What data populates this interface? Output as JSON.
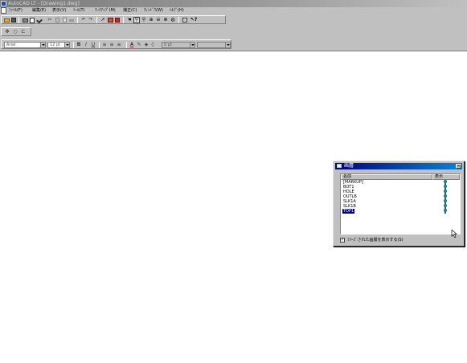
{
  "window": {
    "title": "AutoCAD LT - [Drawing1.dwg]"
  },
  "menubar": {
    "items": [
      "ﾌｧｲﾙ(F)",
      "編集(E)",
      "表示(V)",
      "ﾂｰﾙ(T)",
      "ﾏｰｸｱｯﾌﾟ(M)",
      "補正(C)",
      "ｳｨﾝﾄﾞｳ(W)",
      "ﾍﾙﾌﾟ(H)"
    ]
  },
  "toolbar_format": {
    "font_value": "Arial",
    "size_value": "12 pt",
    "bold_label": "B",
    "italic_label": "I",
    "underline_label": "U",
    "linetype_value": "0 pt",
    "color_value": ""
  },
  "layer_dialog": {
    "title": "画層",
    "close_glyph": "✕",
    "col_name": "名前",
    "col_visible": "表示",
    "layers": [
      {
        "name": "[MARKUP]",
        "visible": true,
        "selected": false
      },
      {
        "name": "BOT1",
        "visible": true,
        "selected": false
      },
      {
        "name": "HOLE",
        "visible": true,
        "selected": false
      },
      {
        "name": "OUTLB",
        "visible": true,
        "selected": false
      },
      {
        "name": "SLK1A",
        "visible": true,
        "selected": false
      },
      {
        "name": "SLK1B",
        "visible": true,
        "selected": false
      },
      {
        "name": "TOP1",
        "visible": true,
        "selected": true
      }
    ],
    "frozen_checkbox_checked": true,
    "frozen_checkbox_label": "ﾌﾘｰｽﾞされた画層を表示する(S)",
    "check_glyph": "✓"
  }
}
